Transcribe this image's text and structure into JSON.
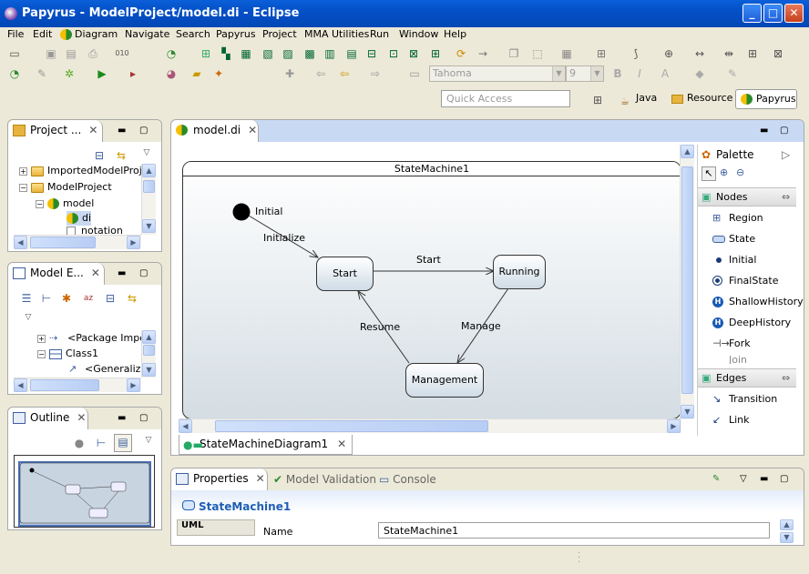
{
  "window": {
    "title": "Papyrus - ModelProject/model.di - Eclipse",
    "minimize": "_",
    "maximize": "□",
    "close": "✕"
  },
  "menu": [
    "File",
    "Edit",
    "Diagram",
    "Navigate",
    "Search",
    "Papyrus",
    "Project",
    "MMA Utilities",
    "Run",
    "Window",
    "Help"
  ],
  "toolbar": {
    "font_name": "Tahoma",
    "font_size": "9",
    "bold": "B",
    "italic": "I",
    "font_a": "A"
  },
  "quick_access": {
    "placeholder": "Quick Access"
  },
  "perspectives": [
    {
      "label": "Java"
    },
    {
      "label": "Resource"
    },
    {
      "label": "Papyrus",
      "active": true
    }
  ],
  "project_explorer": {
    "tab": "Project ...",
    "rows": [
      {
        "label": "ImportedModelProje",
        "level": 0,
        "expander": "+",
        "icon": "folder"
      },
      {
        "label": "ModelProject",
        "level": 0,
        "expander": "−",
        "icon": "project"
      },
      {
        "label": "model",
        "level": 1,
        "expander": "−",
        "icon": "papyrus"
      },
      {
        "label": "di",
        "level": 2,
        "expander": "",
        "icon": "papyrus",
        "selected": true
      },
      {
        "label": "notation",
        "level": 2,
        "expander": "",
        "icon": "file"
      }
    ]
  },
  "model_explorer": {
    "tab": "Model E...",
    "rows": [
      {
        "label": "<Package Impo",
        "expander": "+"
      },
      {
        "label": "Class1",
        "expander": "−"
      },
      {
        "label": "<Generaliza",
        "expander": ""
      }
    ]
  },
  "outline": {
    "tab": "Outline"
  },
  "editor": {
    "tab": "model.di",
    "diagram_tab": "StateMachineDiagram1",
    "state_machine": {
      "name": "StateMachine1",
      "initial_label": "Initial",
      "states": [
        "Start",
        "Running",
        "Management"
      ],
      "transitions": [
        {
          "label": "Initialize"
        },
        {
          "label": "Start"
        },
        {
          "label": "Manage"
        },
        {
          "label": "Resume"
        }
      ]
    }
  },
  "palette": {
    "title": "Palette",
    "nodes_label": "Nodes",
    "nodes": [
      "Region",
      "State",
      "Initial",
      "FinalState",
      "ShallowHistory",
      "DeepHistory",
      "Fork",
      "Join"
    ],
    "edges_label": "Edges",
    "edges": [
      "Transition",
      "Link"
    ]
  },
  "properties": {
    "tabs": [
      "Properties",
      "Model Validation",
      "Console"
    ],
    "title": "StateMachine1",
    "side_tab": "UML",
    "field_label": "Name",
    "field_value": "StateMachine1"
  }
}
